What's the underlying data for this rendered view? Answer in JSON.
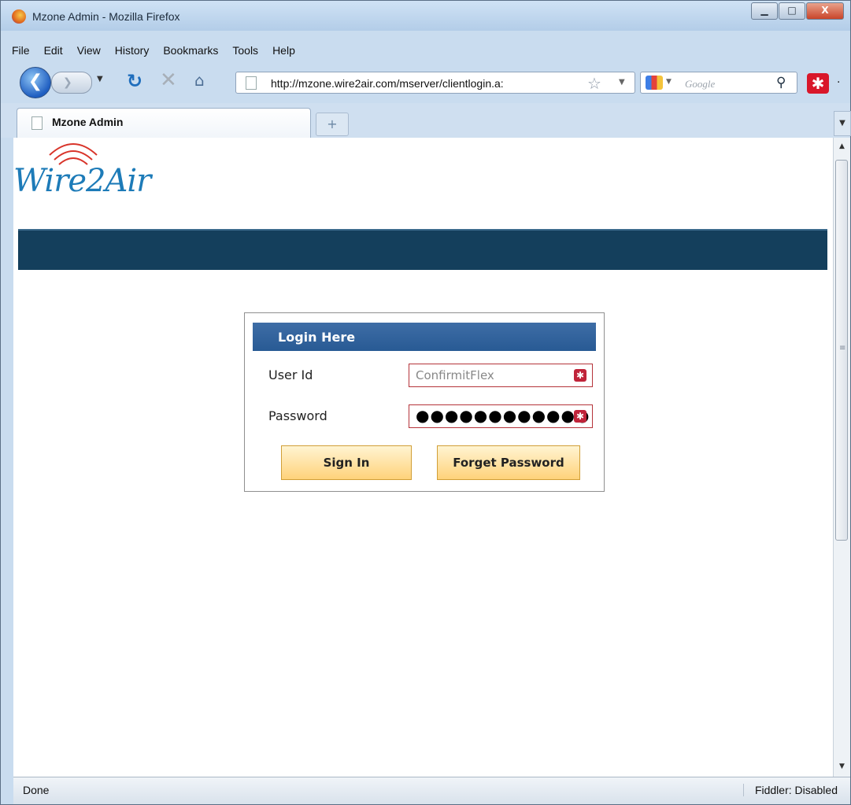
{
  "window": {
    "title": "Mzone Admin - Mozilla Firefox",
    "minimize": "▁",
    "maximize": "□",
    "close": "X"
  },
  "menu": [
    "File",
    "Edit",
    "View",
    "History",
    "Bookmarks",
    "Tools",
    "Help"
  ],
  "nav": {
    "url": "http://mzone.wire2air.com/mserver/clientlogin.a:",
    "search_placeholder": "Google"
  },
  "tabs": [
    {
      "label": "Mzone Admin",
      "active": true
    }
  ],
  "page": {
    "logo_text": "Wire2Air",
    "banner_color": "#143f5c",
    "login": {
      "heading": "Login Here",
      "user_label": "User Id",
      "user_value": "ConfirmitFlex",
      "password_label": "Password",
      "password_value": "●●●●●●●●●●●●",
      "sign_in": "Sign In",
      "forget": "Forget Password"
    }
  },
  "status": {
    "left": "Done",
    "right": "Fiddler: Disabled"
  },
  "colors": {
    "header_blue": "#2f639d",
    "button_gold": "#ffd27a",
    "error_red": "#c0243a"
  }
}
